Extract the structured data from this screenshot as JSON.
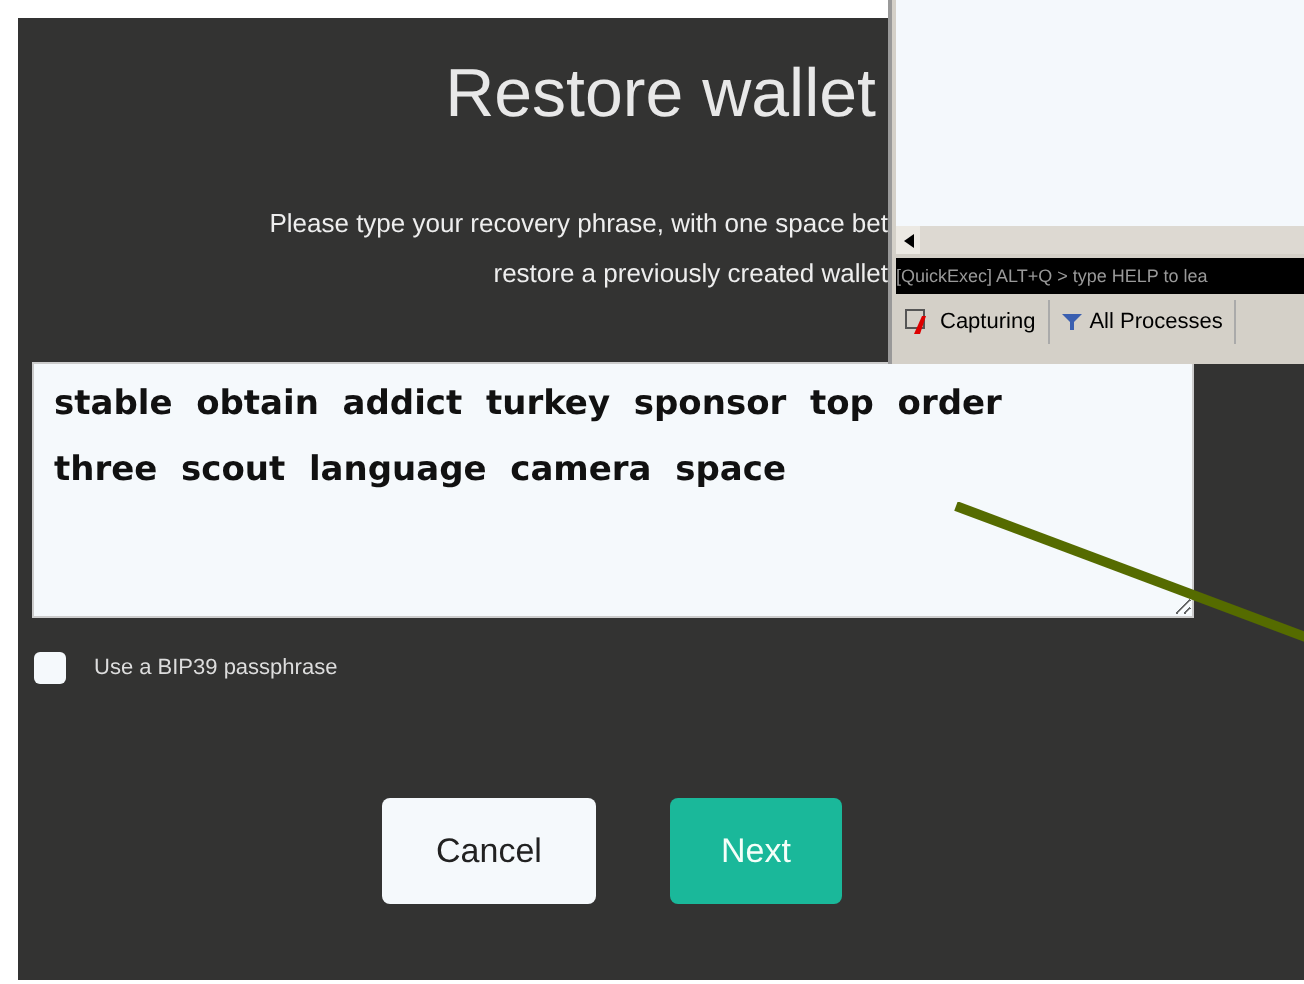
{
  "title": "Restore wallet",
  "description_lines": [
    "Please type your recovery phrase, with one space bet",
    "restore a previously created wallet"
  ],
  "phrase": {
    "value": "stable  obtain  addict  turkey  sponsor  top  order  three  scout  language  camera  space"
  },
  "passphrase_option": {
    "label": "Use a BIP39 passphrase",
    "checked": false
  },
  "buttons": [
    {
      "label": "Cancel",
      "kind": "secondary"
    },
    {
      "label": "Next",
      "kind": "primary"
    }
  ],
  "overlay_window": {
    "command_line": "[QuickExec] ALT+Q > type HELP to lea",
    "status_items": [
      {
        "label": "Capturing",
        "kind": "capture"
      },
      {
        "label": "All Processes",
        "kind": "filter"
      }
    ]
  }
}
